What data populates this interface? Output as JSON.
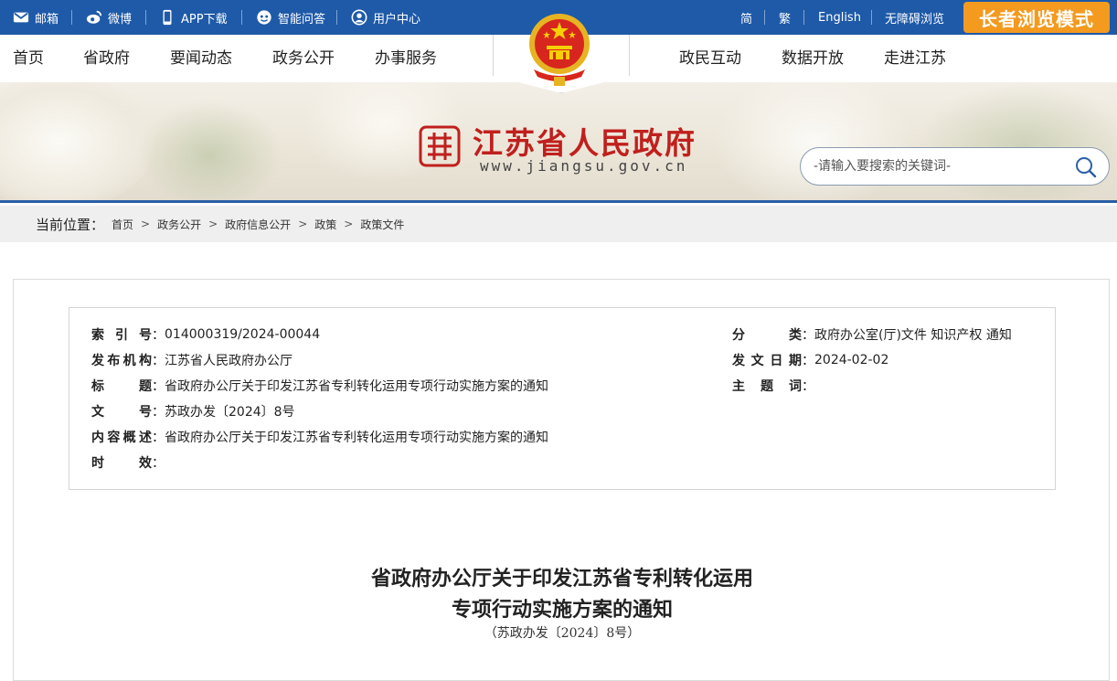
{
  "topbar": {
    "mail": "邮箱",
    "weibo": "微博",
    "app": "APP下载",
    "qa": "智能问答",
    "user": "用户中心",
    "simplified": "简",
    "traditional": "繁",
    "english": "English",
    "accessible": "无障碍浏览",
    "elder_mode": "长者浏览模式"
  },
  "nav": {
    "items_left": [
      "首页",
      "省政府",
      "要闻动态",
      "政务公开",
      "办事服务"
    ],
    "items_right": [
      "政民互动",
      "数据开放",
      "走进江苏"
    ]
  },
  "banner": {
    "site_name": "江苏省人民政府",
    "site_url": "www.jiangsu.gov.cn",
    "search_placeholder": "-请输入要搜索的关键词-"
  },
  "breadcrumb": {
    "label": "当前位置：",
    "items": [
      "首页",
      "政务公开",
      "政府信息公开",
      "政策",
      "政策文件"
    ]
  },
  "meta": {
    "index_no_label": "索引号",
    "index_no": "014000319/2024-00044",
    "category_label": "分类",
    "category": "政府办公室(厅)文件 知识产权 通知",
    "issuer_label": "发布机构",
    "issuer": "江苏省人民政府办公厅",
    "date_label": "发文日期",
    "date": "2024-02-02",
    "title_label": "标题",
    "title": "省政府办公厅关于印发江苏省专利转化运用专项行动实施方案的通知",
    "topic_label": "主题词",
    "topic": "",
    "doc_no_label": "文号",
    "doc_no": "苏政办发〔2024〕8号",
    "summary_label": "内容概述",
    "summary": "省政府办公厅关于印发江苏省专利转化运用专项行动实施方案的通知",
    "validity_label": "时效",
    "validity": ""
  },
  "document": {
    "title_line1": "省政府办公厅关于印发江苏省专利转化运用",
    "title_line2": "专项行动实施方案的通知",
    "doc_no": "（苏政办发〔2024〕8号）"
  },
  "colors": {
    "topbar": "#1e5aa8",
    "elder_button": "#f39a1f",
    "site_name": "#c0201d"
  }
}
